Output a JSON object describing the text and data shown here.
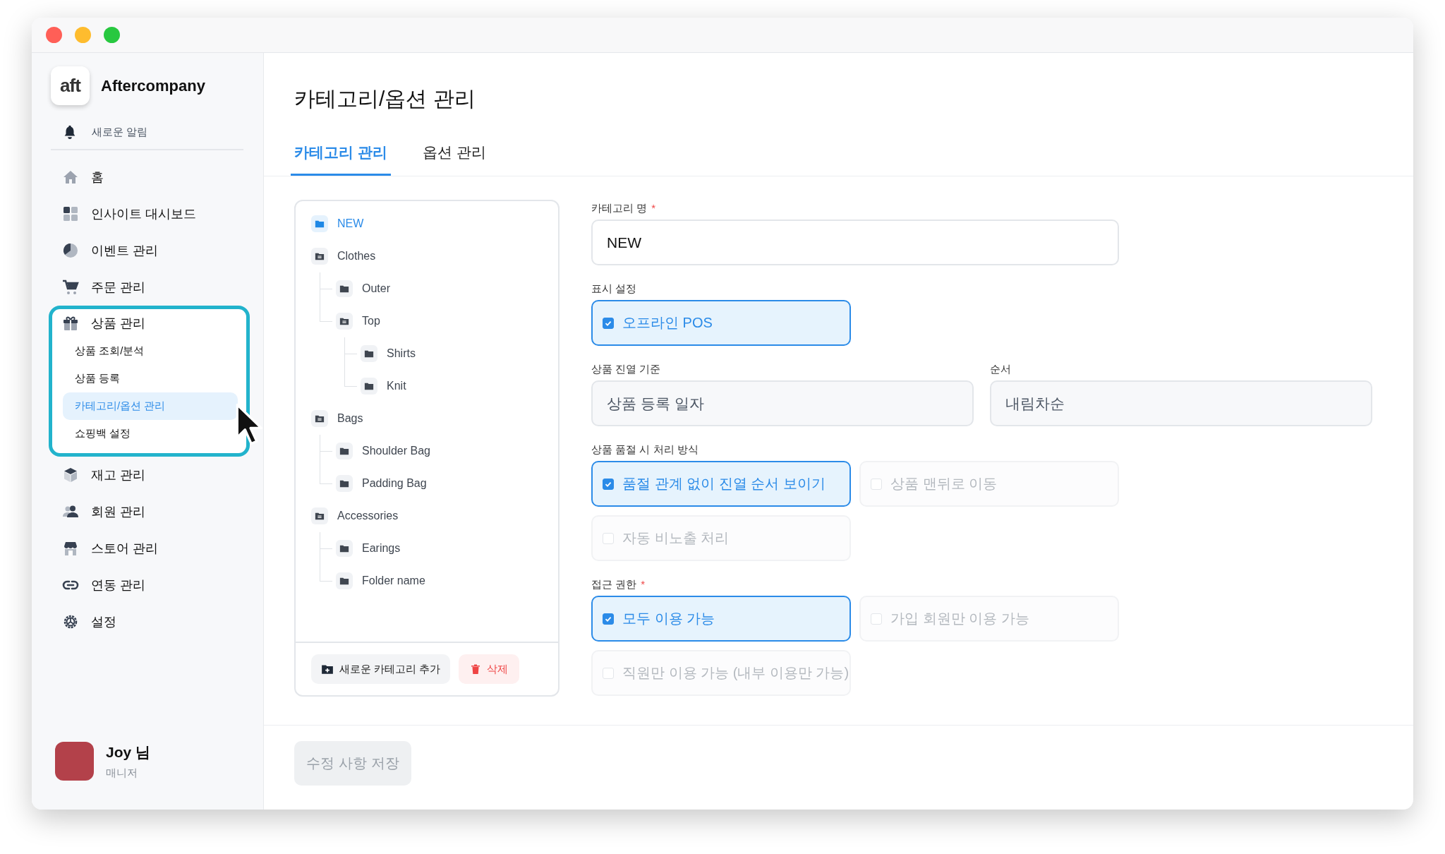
{
  "sidebar": {
    "brand": {
      "logo": "aft",
      "name": "Aftercompany"
    },
    "notification": {
      "label": "새로운 알림"
    },
    "nav": [
      {
        "label": "홈",
        "kind": "home"
      },
      {
        "label": "인사이트 대시보드",
        "kind": "dashboard"
      },
      {
        "label": "이벤트 관리",
        "kind": "pie"
      },
      {
        "label": "주문 관리",
        "kind": "cart"
      },
      {
        "label": "상품 관리",
        "kind": "gift",
        "highlighted": true,
        "children": [
          {
            "label": "상품 조회/분석",
            "selected": false
          },
          {
            "label": "상품 등록",
            "selected": false
          },
          {
            "label": "카테고리/옵션 관리",
            "selected": true
          },
          {
            "label": "쇼핑백 설정",
            "selected": false
          }
        ]
      },
      {
        "label": "재고 관리",
        "kind": "box"
      },
      {
        "label": "회원 관리",
        "kind": "users"
      },
      {
        "label": "스토어 관리",
        "kind": "store"
      },
      {
        "label": "연동 관리",
        "kind": "link"
      },
      {
        "label": "설정",
        "kind": "gear"
      }
    ],
    "user": {
      "name": "Joy 님",
      "role": "매니저"
    }
  },
  "page": {
    "title": "카테고리/옵션 관리"
  },
  "tabs": [
    {
      "label": "카테고리 관리",
      "selected": true
    },
    {
      "label": "옵션 관리",
      "selected": false
    }
  ],
  "tree": {
    "items": [
      {
        "label": "NEW",
        "selected": true
      },
      {
        "label": "Clothes",
        "selected": false,
        "children": [
          {
            "label": "Outer",
            "selected": false
          },
          {
            "label": "Top",
            "selected": false,
            "children": [
              {
                "label": "Shirts",
                "selected": false
              },
              {
                "label": "Knit",
                "selected": false
              }
            ]
          }
        ]
      },
      {
        "label": "Bags",
        "selected": false,
        "children": [
          {
            "label": "Shoulder Bag",
            "selected": false
          },
          {
            "label": "Padding Bag",
            "selected": false
          }
        ]
      },
      {
        "label": "Accessories",
        "selected": false,
        "children": [
          {
            "label": "Earings",
            "selected": false
          },
          {
            "label": "Folder name",
            "selected": false
          }
        ]
      }
    ],
    "add_button": "새로운 카테고리 추가",
    "delete_button": "삭제"
  },
  "form": [
    {
      "kind": "text",
      "label": "카테고리 명",
      "required_mark": "*",
      "value": "NEW"
    },
    {
      "kind": "options",
      "label": "표시 설정",
      "options": [
        {
          "label": "오프라인 POS",
          "checked": true
        }
      ]
    },
    {
      "kind": "selects",
      "fields": [
        {
          "label": "상품 진열 기준",
          "value": "상품 등록 일자"
        },
        {
          "label": "순서",
          "value": "내림차순"
        }
      ]
    },
    {
      "kind": "options",
      "label": "상품 품절 시 처리 방식",
      "options": [
        {
          "label": "품절 관계 없이 진열 순서 보이기",
          "checked": true
        },
        {
          "label": "상품 맨뒤로 이동",
          "checked": false
        },
        {
          "label": "자동 비노출 처리",
          "checked": false
        }
      ]
    },
    {
      "kind": "options",
      "label": "접근 권한",
      "required_mark": "*",
      "options": [
        {
          "label": "모두 이용 가능",
          "checked": true
        },
        {
          "label": "가입 회원만 이용 가능",
          "checked": false
        },
        {
          "label": "직원만 이용 가능 (내부 이용만 가능)",
          "checked": false
        }
      ]
    }
  ],
  "save_button": {
    "label": "수정 사항 저장",
    "disabled": true
  }
}
